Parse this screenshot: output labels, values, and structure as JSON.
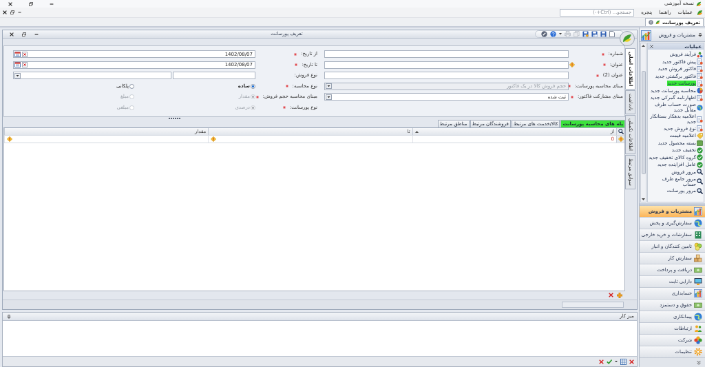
{
  "app_title_bar": {
    "title": "نسخه آموزشی"
  },
  "menu_bar": {
    "items": [
      "عملیات",
      "راهنما",
      "پنجره"
    ],
    "search": {
      "placeholder": "جستجو... (Ctrl+-)"
    }
  },
  "document_tabs": [
    {
      "label": "تعریف پورسانت",
      "selected": true
    }
  ],
  "document_window": {
    "title": "تعریف پورسانت",
    "side_tabs": [
      {
        "label": "اطلاعات اصلی",
        "selected": true
      },
      {
        "label": "یادداشت",
        "selected": false
      },
      {
        "label": "اطلاعات تکمیلی",
        "selected": false
      },
      {
        "label": "سوابق مرتبط",
        "selected": false
      }
    ],
    "form": {
      "right_fields": [
        {
          "kind": "text",
          "label": "شماره:",
          "required": true
        },
        {
          "kind": "text",
          "label": "عنوان:",
          "required": true,
          "warning": true
        },
        {
          "kind": "text",
          "label": "عنوان (2)",
          "required": true
        },
        {
          "kind": "dropdown",
          "label": "مبنای محاسبه پورسانت:",
          "required": true,
          "disabled": true,
          "placeholder": "حجم فروش کالا در یک فاکتور"
        },
        {
          "kind": "dropdown",
          "label": "مبنای مشارکت فاکتور:",
          "required": true,
          "disabled": false,
          "value": "ثبت شده"
        }
      ],
      "left_fields": [
        {
          "kind": "date",
          "label": "از تاریخ:",
          "required": true,
          "value": "1402/08/07"
        },
        {
          "kind": "date",
          "label": "تا تاریخ:",
          "required": true,
          "value": "1402/08/07"
        },
        {
          "kind": "lookup",
          "label": "نوع فروش:"
        },
        {
          "kind": "radio",
          "label": "نوع محاسبه:",
          "required": true,
          "options": [
            {
              "label": "ساده",
              "selected": true,
              "disabled": false
            },
            {
              "label": "پلکانی",
              "selected": false,
              "disabled": false
            }
          ]
        },
        {
          "kind": "radio",
          "label": "مبنای محاسبه حجم فروش:",
          "required": true,
          "options": [
            {
              "label": "مقدار",
              "selected": true,
              "disabled": true
            },
            {
              "label": "مبلغ",
              "selected": false,
              "disabled": true
            }
          ]
        },
        {
          "kind": "radio",
          "label": "نوع پورسانت:",
          "required": true,
          "options": [
            {
              "label": "درصدی",
              "selected": true,
              "disabled": true
            },
            {
              "label": "مبلغی",
              "selected": false,
              "disabled": true
            }
          ]
        }
      ]
    },
    "grid_tabs": [
      {
        "label": "پله های محاسبه پورسانت",
        "selected": true
      },
      {
        "label": "کالا/خدمت های مرتبط",
        "selected": false
      },
      {
        "label": "فروشندگان مرتبط",
        "selected": false
      },
      {
        "label": "مناطق مرتبط",
        "selected": false
      }
    ],
    "table": {
      "columns": [
        {
          "label": "از",
          "sorted": true
        },
        {
          "label": "تا",
          "sorted": false
        },
        {
          "label": "مقدار",
          "sorted": false
        }
      ],
      "rows": [
        {
          "warning": true,
          "cells": [
            {
              "value": "0"
            },
            {
              "warning": true
            },
            {
              "warning": true
            }
          ]
        }
      ]
    }
  },
  "bottom_pane": {
    "title": "میز کار"
  },
  "sidebar": {
    "header": "مشتریات و فروش",
    "section": "عملیات",
    "items": [
      {
        "label": "فرآیند فروش",
        "selected": false
      },
      {
        "label": "پیش فاکتور جدید",
        "selected": false
      },
      {
        "label": "فاکتور فروش جدید",
        "selected": false
      },
      {
        "label": "فاکتور برگشتی جدید",
        "selected": false
      },
      {
        "label": "پورسانت جدید",
        "selected": true
      },
      {
        "label": "محاسبه پورسانت جدید",
        "selected": false
      },
      {
        "label": "اظهارنامه گمرکی جدید",
        "selected": false
      },
      {
        "label": "صورت حساب طرف مقابل جدید",
        "selected": false
      },
      {
        "label": "اعلامیه بدهکار بستانکار جدید",
        "selected": false
      },
      {
        "label": "نوع فروش جدید",
        "selected": false
      },
      {
        "label": "اعلامیه قیمت",
        "selected": false
      },
      {
        "label": "بسته محصول جدید",
        "selected": false
      },
      {
        "label": "تخفیف جدید",
        "selected": false
      },
      {
        "label": "گروه کالای تخفیف جدید",
        "selected": false
      },
      {
        "label": "عامل افزاینده جدید",
        "selected": false
      },
      {
        "label": "مرور فروش",
        "selected": false
      },
      {
        "label": "مرور جامع طرف حساب",
        "selected": false
      },
      {
        "label": "مرور پورسانت",
        "selected": false
      }
    ],
    "modules": [
      {
        "label": "مشتریات و فروش",
        "selected": true
      },
      {
        "label": "سفارش‌گیری و پخش",
        "selected": false
      },
      {
        "label": "سفارشات و خرید خارجی",
        "selected": false
      },
      {
        "label": "تامین کنندگان و انبار",
        "selected": false
      },
      {
        "label": "سفارش کار",
        "selected": false
      },
      {
        "label": "دریافت و پرداخت",
        "selected": false
      },
      {
        "label": "دارایی ثابت",
        "selected": false
      },
      {
        "label": "حسابداری",
        "selected": false
      },
      {
        "label": "حقوق و دستمزد",
        "selected": false
      },
      {
        "label": "پیمانکاری",
        "selected": false
      },
      {
        "label": "ارتباطات",
        "selected": false
      },
      {
        "label": "شرکت",
        "selected": false
      },
      {
        "label": "تنظیمات",
        "selected": false
      }
    ]
  }
}
